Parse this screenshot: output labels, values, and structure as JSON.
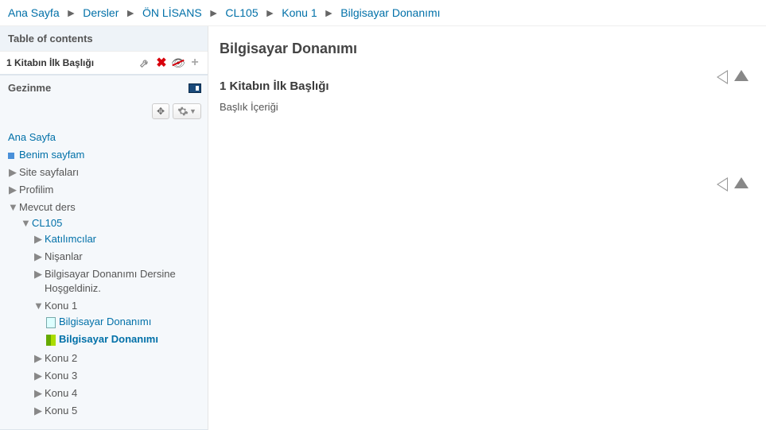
{
  "breadcrumb": [
    {
      "label": "Ana Sayfa",
      "link": true
    },
    {
      "label": "Dersler",
      "link": true
    },
    {
      "label": "ÖN LİSANS",
      "link": true
    },
    {
      "label": "CL105",
      "link": true
    },
    {
      "label": "Konu 1",
      "link": true
    },
    {
      "label": "Bilgisayar Donanımı",
      "link": true
    }
  ],
  "toc": {
    "header": "Table of contents",
    "current": "1 Kitabın İlk Başlığı"
  },
  "nav": {
    "header": "Gezinme",
    "root": "Ana Sayfa",
    "items": {
      "mypage": "Benim sayfam",
      "sitepages": "Site sayfaları",
      "profile": "Profilim",
      "currentcourse": "Mevcut ders",
      "coursecode": "CL105",
      "participants": "Katılımcılar",
      "badges": "Nişanlar",
      "welcome": "Bilgisayar Donanımı Dersine Hoşgeldiniz.",
      "topic1": "Konu 1",
      "topic1_res1": "Bilgisayar Donanımı",
      "topic1_res2": "Bilgisayar Donanımı",
      "topic2": "Konu 2",
      "topic3": "Konu 3",
      "topic4": "Konu 4",
      "topic5": "Konu 5"
    }
  },
  "page": {
    "title": "Bilgisayar Donanımı",
    "chapter_title": "1 Kitabın İlk Başlığı",
    "chapter_body": "Başlık İçeriği"
  }
}
